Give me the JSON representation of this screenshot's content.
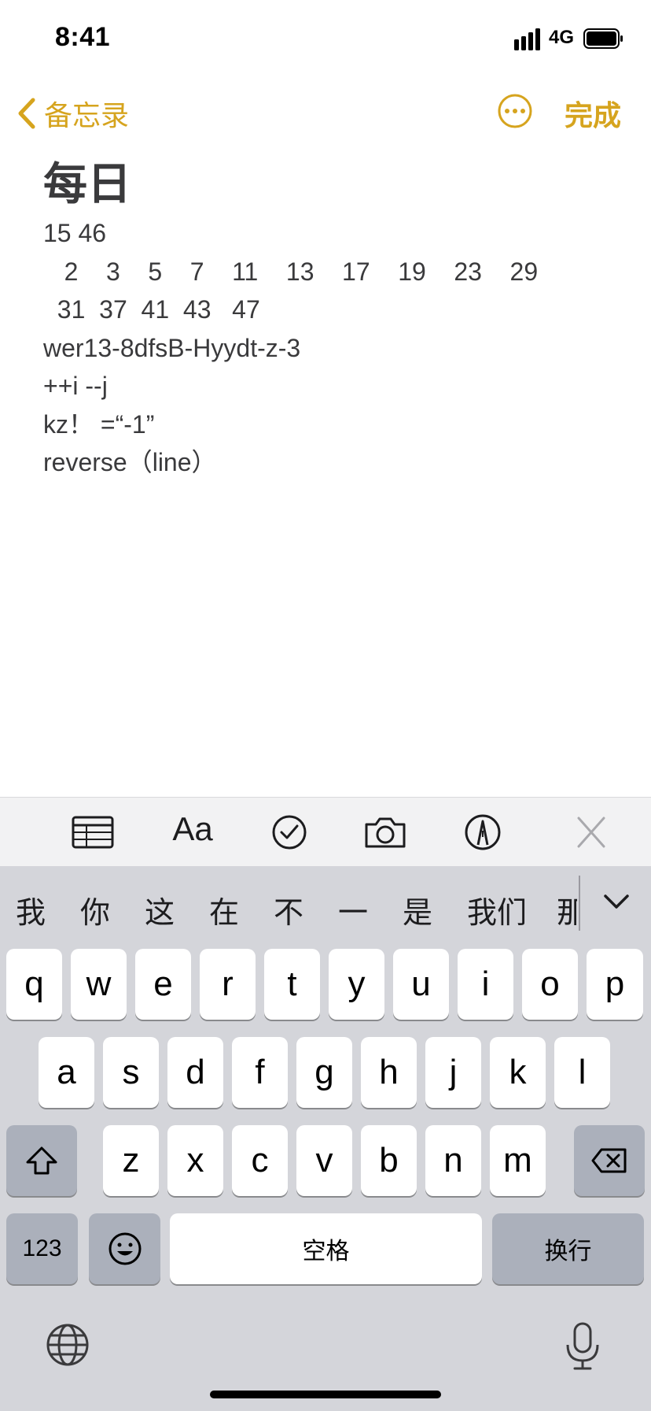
{
  "status": {
    "time": "8:41",
    "network": "4G"
  },
  "nav": {
    "back_label": "备忘录",
    "done_label": "完成"
  },
  "note": {
    "title": "每日",
    "lines": [
      "15 46",
      "   2    3    5    7    11    13    17    19    23    29",
      "  31  37  41  43   47",
      "wer13-8dfsB-Hyydt-z-3",
      "++i --j",
      "kz！ =“-1”",
      "reverse（line）"
    ]
  },
  "toolbar": {
    "format_label": "Aa"
  },
  "keyboard": {
    "candidates": [
      "我",
      "你",
      "这",
      "在",
      "不",
      "一",
      "是",
      "我们",
      "那"
    ],
    "row1": [
      "q",
      "w",
      "e",
      "r",
      "t",
      "y",
      "u",
      "i",
      "o",
      "p"
    ],
    "row2": [
      "a",
      "s",
      "d",
      "f",
      "g",
      "h",
      "j",
      "k",
      "l"
    ],
    "row3": [
      "z",
      "x",
      "c",
      "v",
      "b",
      "n",
      "m"
    ],
    "numbers_label": "123",
    "space_label": "空格",
    "return_label": "换行"
  },
  "colors": {
    "accent": "#d6a41e",
    "keyboard_bg": "#d4d5da",
    "dark_key": "#abb0bb"
  }
}
